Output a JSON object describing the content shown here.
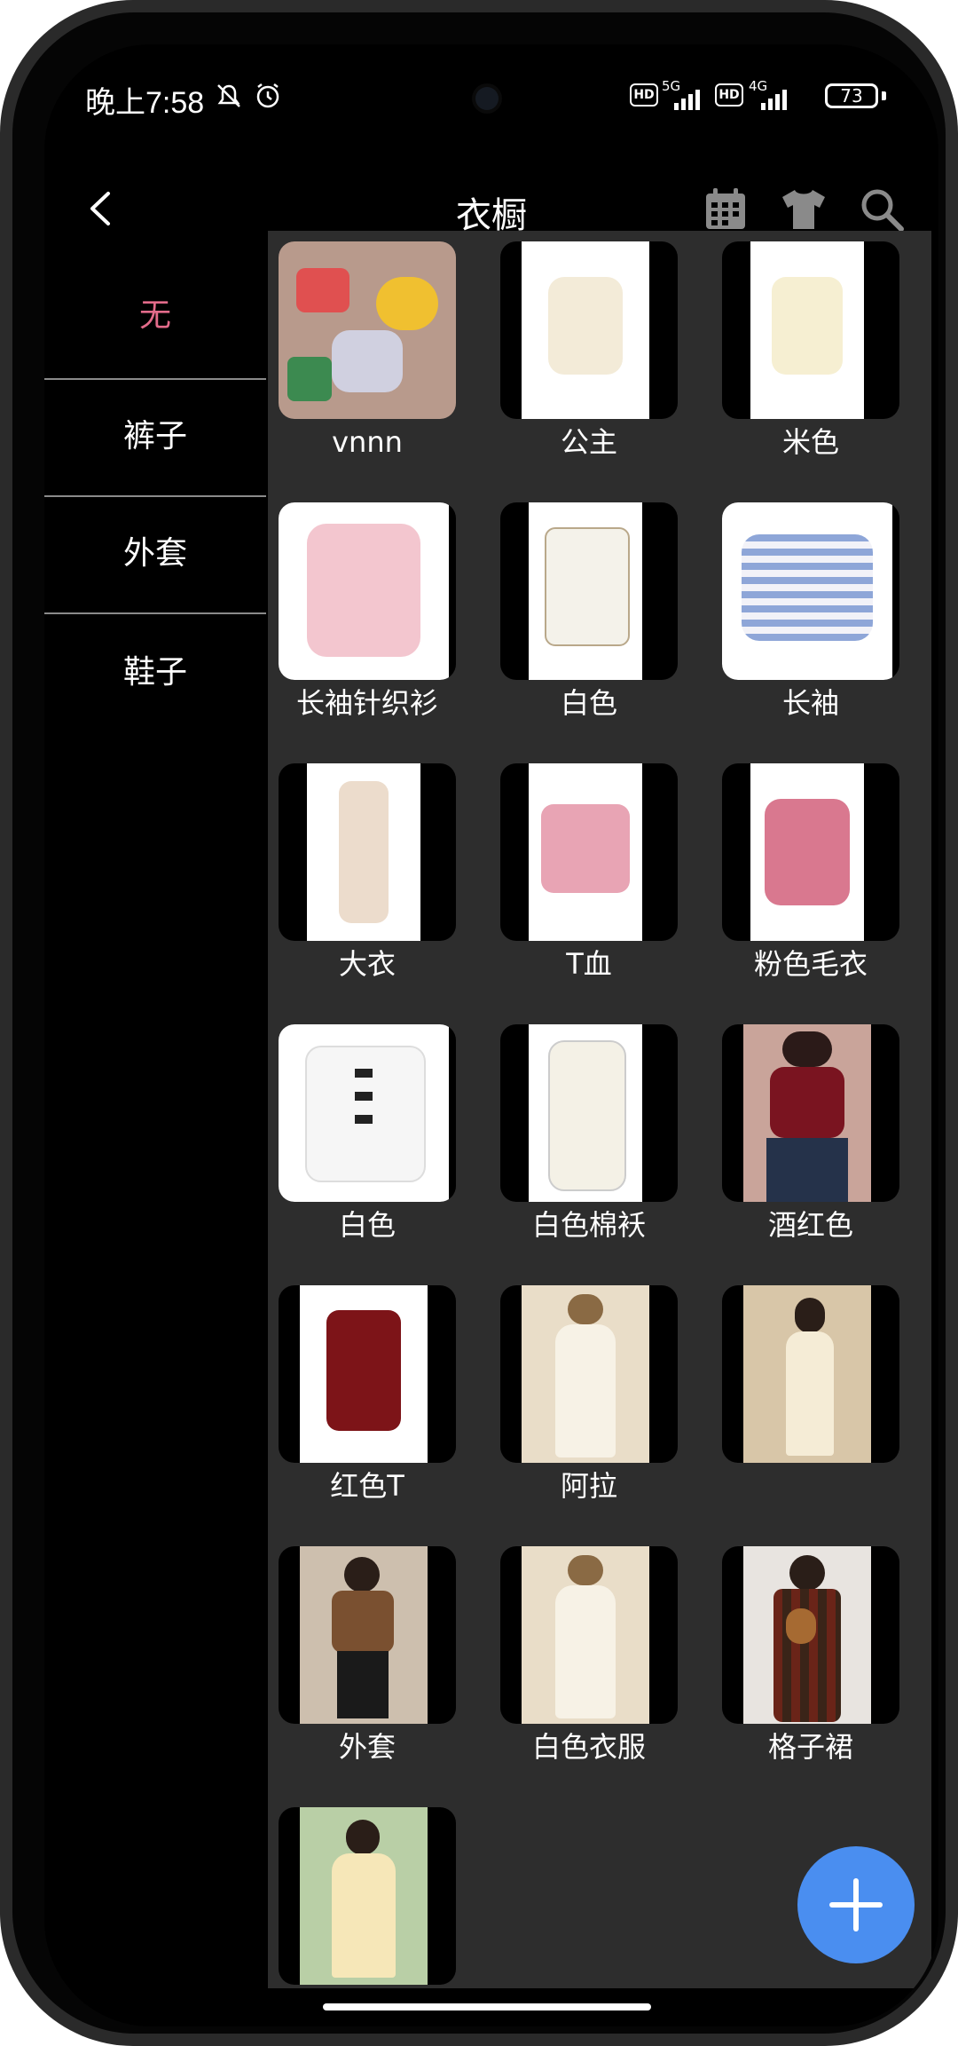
{
  "status_bar": {
    "time": "晚上7:58",
    "battery": "73",
    "hd1": "HD",
    "net1": "5G",
    "hd2": "HD",
    "net2": "4G"
  },
  "header": {
    "title": "衣橱",
    "icons": [
      "back-icon",
      "calendar-icon",
      "shirt-icon",
      "search-icon"
    ]
  },
  "categories": [
    {
      "label": "无",
      "active": true
    },
    {
      "label": "裤子",
      "active": false
    },
    {
      "label": "外套",
      "active": false
    },
    {
      "label": "鞋子",
      "active": false
    }
  ],
  "items": [
    {
      "label": "vnnn"
    },
    {
      "label": "公主"
    },
    {
      "label": "米色"
    },
    {
      "label": "长袖针织衫"
    },
    {
      "label": "白色"
    },
    {
      "label": "长袖"
    },
    {
      "label": "大衣"
    },
    {
      "label": "T血"
    },
    {
      "label": "粉色毛衣"
    },
    {
      "label": "白色"
    },
    {
      "label": "白色棉袄"
    },
    {
      "label": "酒红色"
    },
    {
      "label": "红色T"
    },
    {
      "label": "阿拉"
    },
    {
      "label": ""
    },
    {
      "label": "外套"
    },
    {
      "label": "白色衣服"
    },
    {
      "label": "格子裙"
    },
    {
      "label": ""
    }
  ],
  "colors": {
    "accent": "#e26b8a",
    "fab": "#4a8ef0",
    "grid_bg": "#2d2d2d"
  }
}
